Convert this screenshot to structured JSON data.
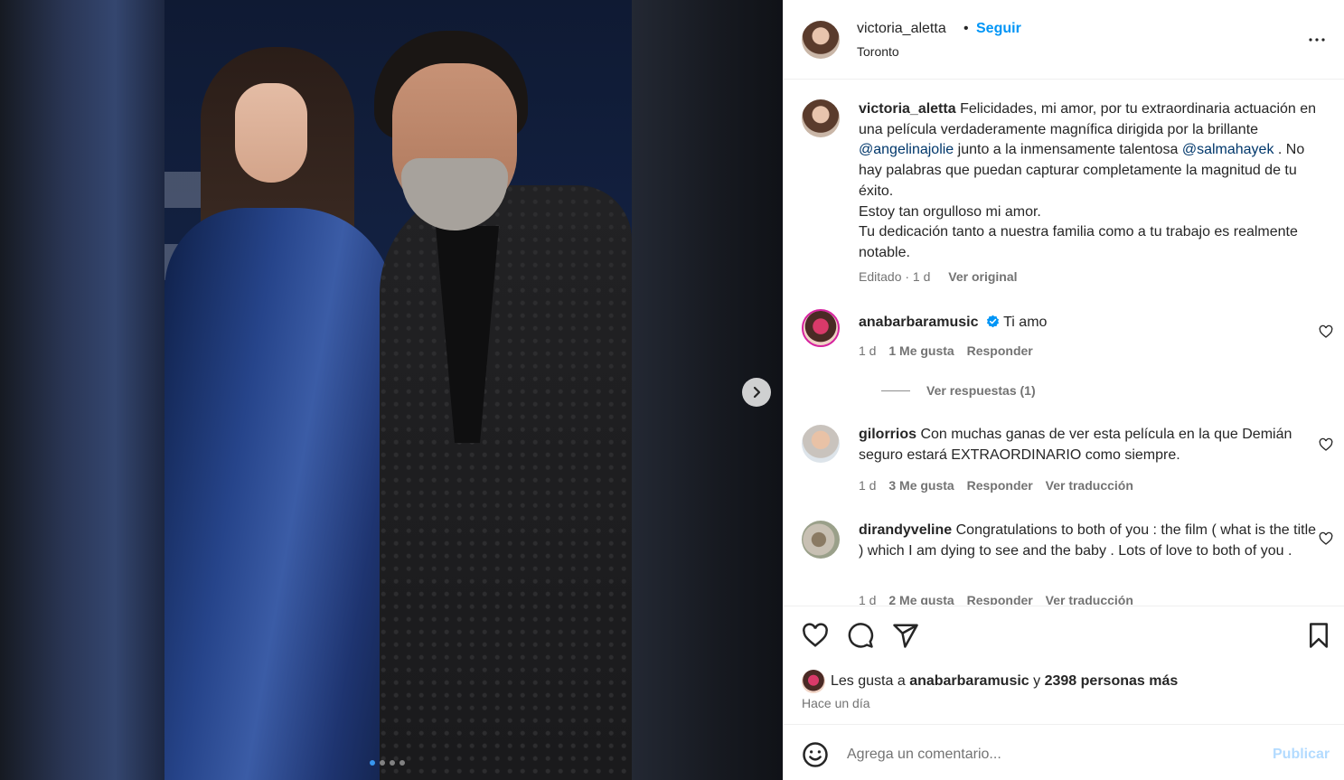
{
  "post": {
    "username": "victoria_aletta",
    "separator": "•",
    "follow_label": "Seguir",
    "location": "Toronto",
    "media_slides": 4,
    "active_slide": 1
  },
  "caption": {
    "username": "victoria_aletta",
    "text_1": "Felicidades, mi amor, por tu extraordinaria actuación en una película verdaderamente magnífica dirigida por la brillante",
    "mention_1": "@angelinajolie",
    "text_2": "junto a la inmensamente talentosa",
    "mention_2": "@salmahayek",
    "text_3": ". No hay palabras que puedan capturar completamente la magnitud de tu éxito.",
    "line_2": "Estoy tan orgulloso mi amor.",
    "line_3": "Tu dedicación tanto a nuestra familia como a tu trabajo es realmente notable.",
    "edited": "Editado · 1 d",
    "see_original": "Ver original"
  },
  "comments": [
    {
      "username": "anabarbaramusic",
      "verified": true,
      "text": "Ti amo",
      "time": "1 d",
      "likes": "1 Me gusta",
      "reply": "Responder",
      "view_replies": "Ver respuestas (1)"
    },
    {
      "username": "gilorrios",
      "text": "Con muchas ganas de ver esta película en la que Demián seguro estará EXTRAORDINARIO como siempre.",
      "time": "1 d",
      "likes": "3 Me gusta",
      "reply": "Responder",
      "translate": "Ver traducción"
    },
    {
      "username": "dirandyveline",
      "text": "Congratulations to both of you : the film ( what is the title ) which I am dying to see and the baby . Lots of love to both of you .",
      "time": "1 d",
      "likes": "2 Me gusta",
      "reply": "Responder",
      "translate": "Ver traducción"
    }
  ],
  "likes": {
    "prefix": "Les gusta a",
    "user": "anabarbaramusic",
    "connector": "y",
    "others": "2398 personas más",
    "time_ago": "Hace un día"
  },
  "add_comment": {
    "placeholder": "Agrega un comentario...",
    "publish_label": "Publicar"
  },
  "icons": [
    "more-icon",
    "heart-icon",
    "comment-icon",
    "share-icon",
    "bookmark-icon",
    "emoji-icon",
    "chevron-right-icon",
    "verified-icon"
  ],
  "colors": {
    "accent": "#0095f6",
    "mention": "#00376b",
    "muted": "#737373",
    "publish_disabled": "#b3dbff",
    "verified": "#0095f6"
  }
}
